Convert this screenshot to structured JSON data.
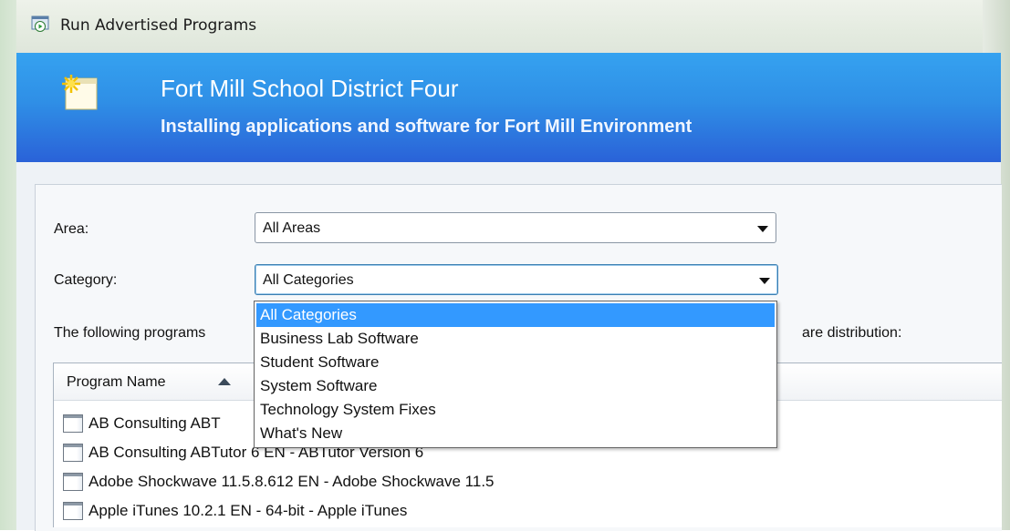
{
  "window": {
    "title": "Run Advertised Programs"
  },
  "banner": {
    "title": "Fort Mill School District Four",
    "subtitle": "Installing applications and software for Fort Mill Environment",
    "icon": "star-window-icon"
  },
  "filters": {
    "area_label": "Area:",
    "area_value": "All Areas",
    "category_label": "Category:",
    "category_value": "All Categories"
  },
  "description": {
    "text_left": "The following programs",
    "text_right": "are distribution:"
  },
  "list": {
    "column_header": "Program Name",
    "rows": [
      "AB Consulting ABT",
      "AB Consulting ABTutor 6 EN - ABTutor Version 6",
      "Adobe Shockwave 11.5.8.612 EN - Adobe Shockwave 11.5",
      "Apple iTunes 10.2.1 EN - 64-bit - Apple iTunes"
    ]
  },
  "category_dropdown": {
    "options": [
      "All Categories",
      "Business Lab Software",
      "Student Software",
      "System Software",
      "Technology System Fixes",
      "What's New"
    ],
    "selected_index": 0
  },
  "colors": {
    "banner_top": "#35a2f0",
    "banner_bottom": "#2a62d8",
    "selection": "#3399ff"
  }
}
